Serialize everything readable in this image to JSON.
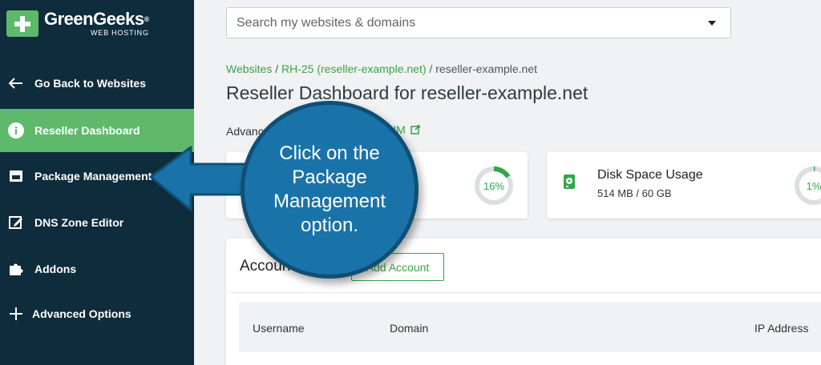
{
  "sidebar": {
    "logo": {
      "name": "GreenGeeks",
      "registered": "®",
      "sub": "WEB HOSTING"
    },
    "items": [
      {
        "label": "Go Back to Websites",
        "icon": "arrow-left-icon"
      },
      {
        "label": "Reseller Dashboard",
        "icon": "info-icon",
        "active": true
      },
      {
        "label": "Package Management",
        "icon": "package-icon"
      },
      {
        "label": "DNS Zone Editor",
        "icon": "edit-icon"
      },
      {
        "label": "Addons",
        "icon": "puzzle-icon"
      },
      {
        "label": "Advanced Options",
        "icon": "plus-icon"
      }
    ]
  },
  "search": {
    "placeholder": "Search my websites & domains"
  },
  "breadcrumb": {
    "item1": "Websites",
    "sep": "/",
    "item2": "RH-25 (reseller-example.net)",
    "current": "reseller-example.net"
  },
  "page_title": "Reseller Dashboard for reseller-example.net",
  "advanced": {
    "prefix": "Advanc",
    "link_suffix": "HM"
  },
  "cards": [
    {
      "percent_text": "16%",
      "percent": 16
    },
    {
      "title": "Disk Space Usage",
      "value": "514 MB / 60 GB",
      "percent_text": "1%",
      "percent": 1
    }
  ],
  "accounts": {
    "title": "Accounts",
    "add_button": "Add Account",
    "columns": [
      "Username",
      "Domain",
      "IP Address"
    ]
  },
  "callout": {
    "text": "Click on the Package Management option."
  },
  "colors": {
    "brand_green": "#5fb96b",
    "sidebar": "#0e2c3b",
    "callout_blue": "#1a73a8",
    "link_green": "#3aa34a"
  }
}
